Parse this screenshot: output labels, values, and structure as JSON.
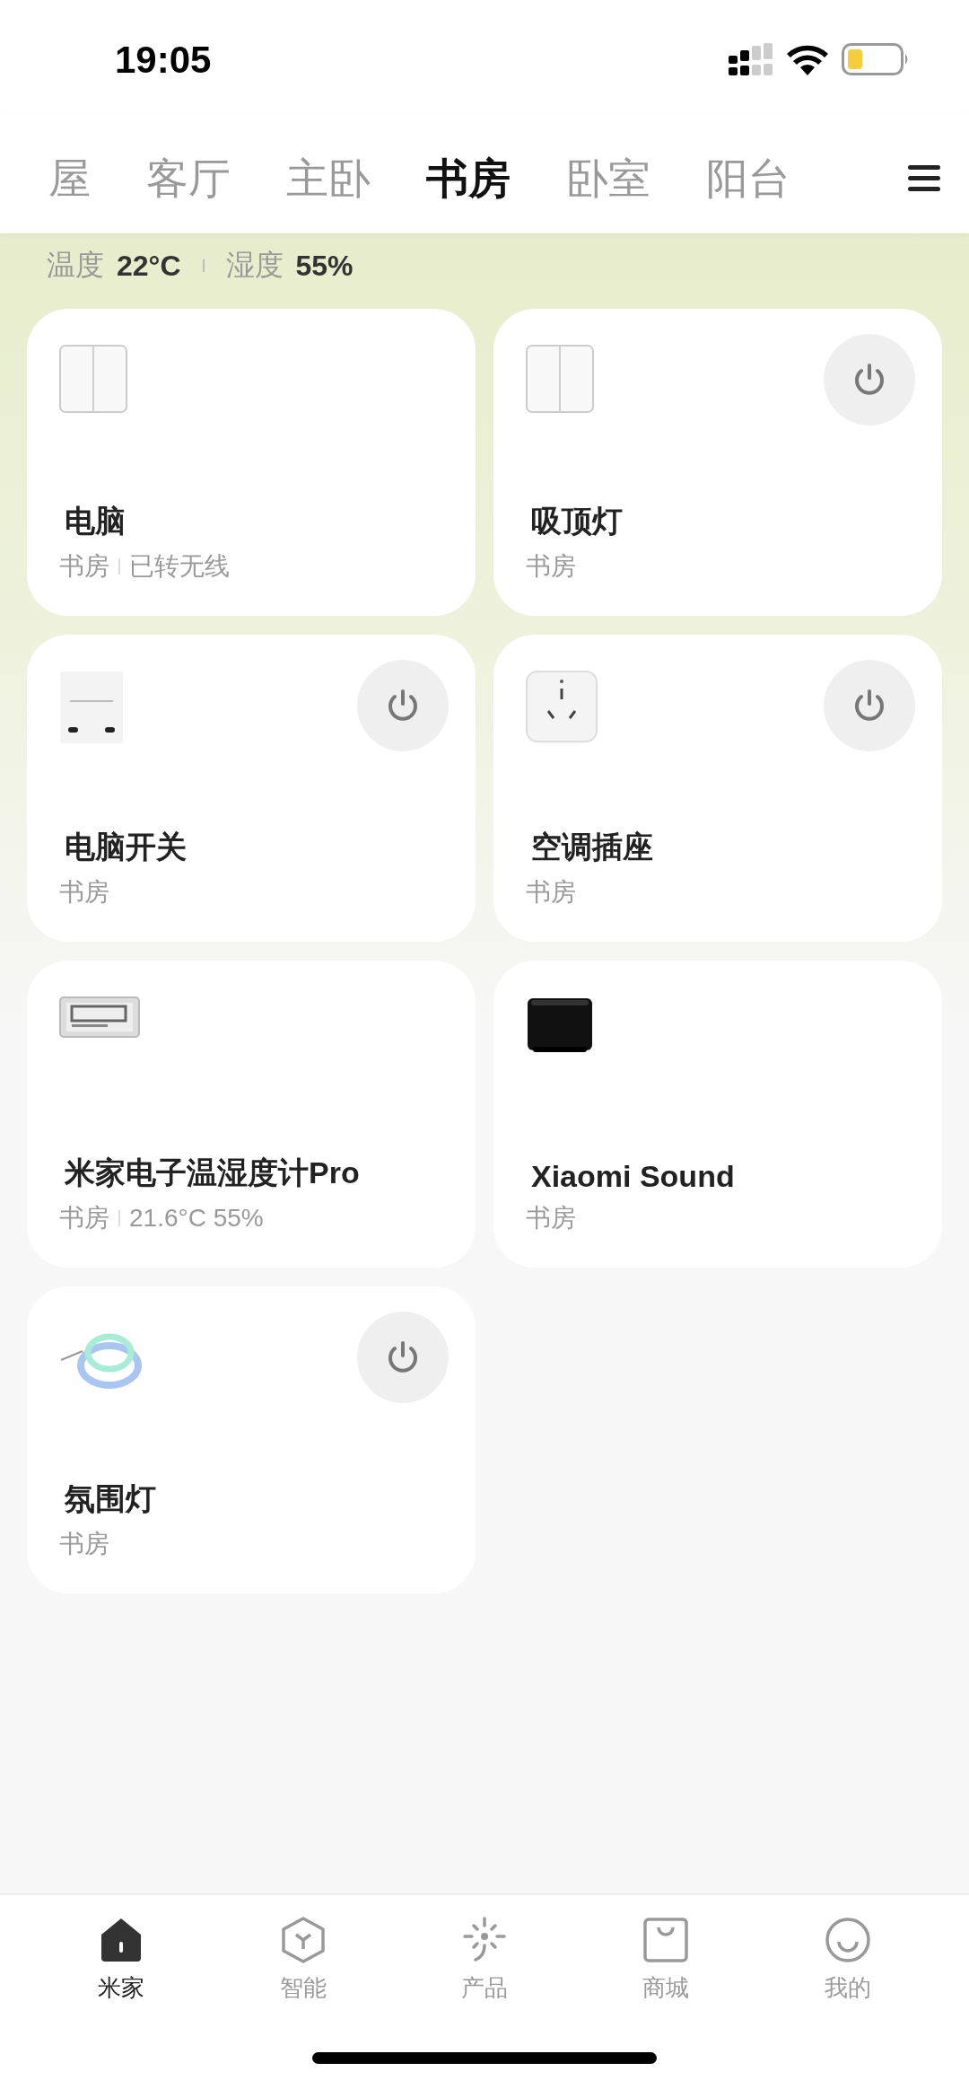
{
  "status_bar": {
    "time": "19:05"
  },
  "room_tabs": [
    {
      "label": "屋",
      "selected": false
    },
    {
      "label": "客厅",
      "selected": false
    },
    {
      "label": "主卧",
      "selected": false
    },
    {
      "label": "书房",
      "selected": true
    },
    {
      "label": "卧室",
      "selected": false
    },
    {
      "label": "阳台",
      "selected": false
    }
  ],
  "climate": [
    {
      "label": "温度",
      "value": "22°C"
    },
    {
      "label": "湿度",
      "value": "55%"
    }
  ],
  "devices": [
    {
      "kind": "switch",
      "name": "电脑",
      "room": "书房",
      "detail": "已转无线",
      "power_button": false
    },
    {
      "kind": "switch",
      "name": "吸顶灯",
      "room": "书房",
      "power_button": true
    },
    {
      "kind": "controller",
      "name": "电脑开关",
      "room": "书房",
      "power_button": true
    },
    {
      "kind": "socket",
      "name": "空调插座",
      "room": "书房",
      "power_button": true
    },
    {
      "kind": "hygrometer",
      "name": "米家电子温湿度计Pro",
      "room": "书房",
      "detail": "21.6°C 55%",
      "power_button": false
    },
    {
      "kind": "speaker",
      "name": "Xiaomi Sound",
      "room": "书房",
      "power_button": false
    },
    {
      "kind": "light-strip",
      "name": "氛围灯",
      "room": "书房",
      "power_button": true
    }
  ],
  "bottom_nav": [
    {
      "kind": "home",
      "label": "米家",
      "selected": true
    },
    {
      "kind": "smart",
      "label": "智能",
      "selected": false
    },
    {
      "kind": "product",
      "label": "产品",
      "selected": false
    },
    {
      "kind": "store",
      "label": "商城",
      "selected": false
    },
    {
      "kind": "profile",
      "label": "我的",
      "selected": false
    }
  ]
}
